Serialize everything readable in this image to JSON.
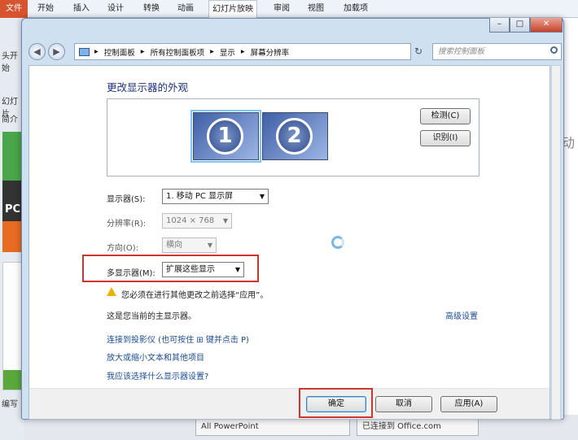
{
  "ppt": {
    "file_tab": "文件",
    "tabs": [
      "开始",
      "插入",
      "设计",
      "转换",
      "动画",
      "幻灯片放映",
      "审阅",
      "视图",
      "加载项"
    ],
    "left_snippets": [
      "头开始",
      "幻灯片",
      "简介"
    ],
    "thumb_text": "PC",
    "bottom_left": "编写",
    "status_left": "All PowerPoint",
    "status_right": "已连接到 Office.com",
    "right_char": "动"
  },
  "window": {
    "controls": {
      "minimize": "–",
      "maximize": "□",
      "close": "✕"
    },
    "back_glyph": "◀",
    "forward_glyph": "▶",
    "breadcrumb": [
      "控制面板",
      "所有控制面板项",
      "显示",
      "屏幕分辨率"
    ],
    "breadcrumb_sep": "▸",
    "refresh_glyph": "↻",
    "search_placeholder": "搜索控制面板"
  },
  "page": {
    "title": "更改显示器的外观",
    "monitor1": "1",
    "monitor2": "2",
    "detect_button": "检测(C)",
    "identify_button": "识别(I)",
    "display_label": "显示器(S):",
    "display_value": "1. 移动 PC 显示屏",
    "resolution_label": "分辨率(R):",
    "resolution_value": "1024 × 768",
    "orientation_label": "方向(O):",
    "orientation_value": "横向",
    "multi_label": "多显示器(M):",
    "multi_value": "扩展这些显示",
    "warning": "您必须在进行其他更改之前选择“应用”。",
    "primary_note": "这是您当前的主显示器。",
    "advanced_link": "高级设置",
    "link_projector": "连接到投影仪 (也可按住 ⊞ 键并点击 P)",
    "link_text_size": "放大或缩小文本和其他项目",
    "link_which": "我应该选择什么显示器设置?",
    "ok_button": "确定",
    "cancel_button": "取消",
    "apply_button": "应用(A)"
  }
}
